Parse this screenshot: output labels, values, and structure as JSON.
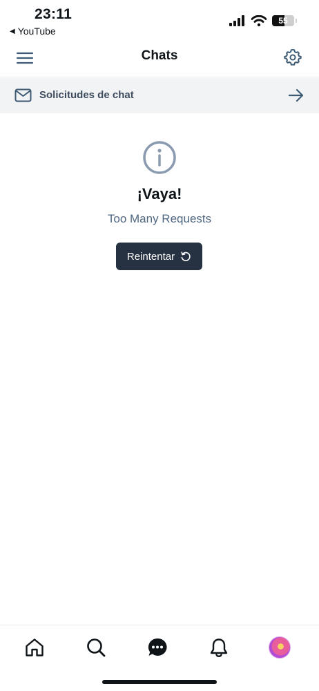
{
  "status_bar": {
    "time": "23:11",
    "back_label": "YouTube",
    "battery": "55"
  },
  "header": {
    "title": "Chats"
  },
  "requests": {
    "label": "Solicitudes de chat"
  },
  "error": {
    "title": "¡Vaya!",
    "message": "Too Many Requests",
    "retry_label": "Reintentar"
  },
  "bottom_nav": {
    "items": [
      "home-icon",
      "search-icon",
      "chat-icon",
      "bell-icon",
      "avatar"
    ],
    "active": "chat-icon"
  },
  "colors": {
    "text": "#0f1419",
    "muted": "#4f6782",
    "icon": "#3d5a74",
    "button": "#263241",
    "bar_background": "#f1f3f5"
  }
}
